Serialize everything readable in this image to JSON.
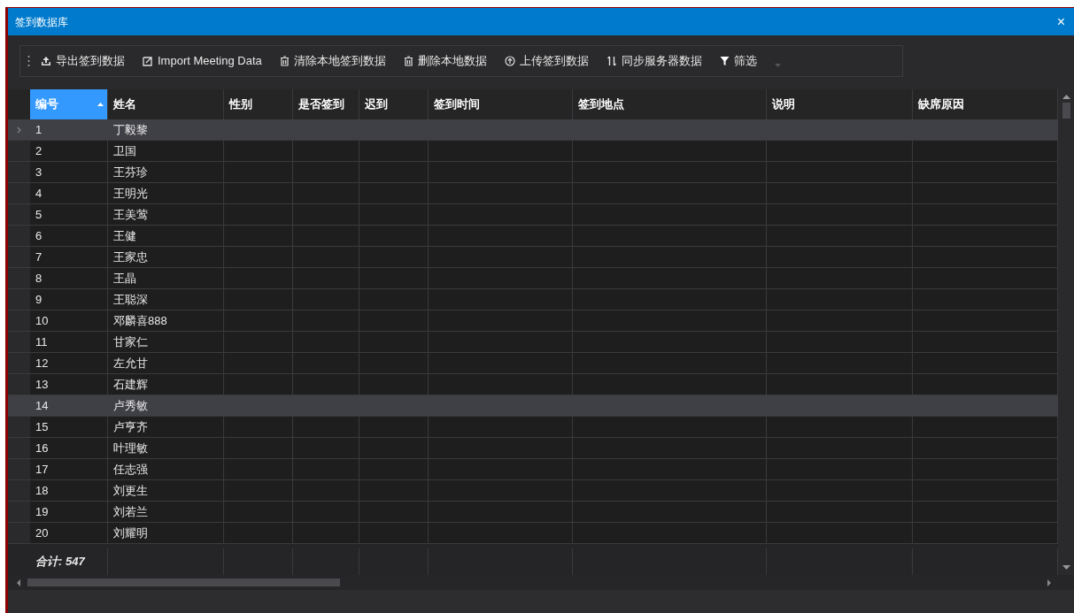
{
  "window": {
    "title": "签到数据库",
    "close": "×"
  },
  "toolbar": [
    "导出签到数据",
    "Import Meeting Data",
    "清除本地签到数据",
    "删除本地数据",
    "上传签到数据",
    "同步服务器数据",
    "筛选"
  ],
  "table": {
    "columns": [
      {
        "label": "编号",
        "sorted": true
      },
      {
        "label": "姓名",
        "sorted": false
      },
      {
        "label": "性别",
        "sorted": false
      },
      {
        "label": "是否签到",
        "sorted": false
      },
      {
        "label": "迟到",
        "sorted": false
      },
      {
        "label": "签到时间",
        "sorted": false
      },
      {
        "label": "签到地点",
        "sorted": false
      },
      {
        "label": "说明",
        "sorted": false
      },
      {
        "label": "缺席原因",
        "sorted": false
      }
    ],
    "rows": [
      {
        "id": "1",
        "name": "丁毅黎",
        "selected": true,
        "current": true
      },
      {
        "id": "2",
        "name": "卫国",
        "selected": false,
        "current": false
      },
      {
        "id": "3",
        "name": "王芬珍",
        "selected": false,
        "current": false
      },
      {
        "id": "4",
        "name": "王明光",
        "selected": false,
        "current": false
      },
      {
        "id": "5",
        "name": "王美莺",
        "selected": false,
        "current": false
      },
      {
        "id": "6",
        "name": "王健",
        "selected": false,
        "current": false
      },
      {
        "id": "7",
        "name": "王家忠",
        "selected": false,
        "current": false
      },
      {
        "id": "8",
        "name": "王晶",
        "selected": false,
        "current": false
      },
      {
        "id": "9",
        "name": "王聪深",
        "selected": false,
        "current": false
      },
      {
        "id": "10",
        "name": "邓麟喜888",
        "selected": false,
        "current": false
      },
      {
        "id": "11",
        "name": "甘家仁",
        "selected": false,
        "current": false
      },
      {
        "id": "12",
        "name": "左允甘",
        "selected": false,
        "current": false
      },
      {
        "id": "13",
        "name": "石建辉",
        "selected": false,
        "current": false
      },
      {
        "id": "14",
        "name": "卢秀敏",
        "selected": true,
        "current": false
      },
      {
        "id": "15",
        "name": "卢亨齐",
        "selected": false,
        "current": false
      },
      {
        "id": "16",
        "name": "叶理敏",
        "selected": false,
        "current": false
      },
      {
        "id": "17",
        "name": "任志强",
        "selected": false,
        "current": false
      },
      {
        "id": "18",
        "name": "刘更生",
        "selected": false,
        "current": false
      },
      {
        "id": "19",
        "name": "刘若兰",
        "selected": false,
        "current": false
      },
      {
        "id": "20",
        "name": "刘耀明",
        "selected": false,
        "current": false
      }
    ],
    "total": "合计: 547"
  }
}
